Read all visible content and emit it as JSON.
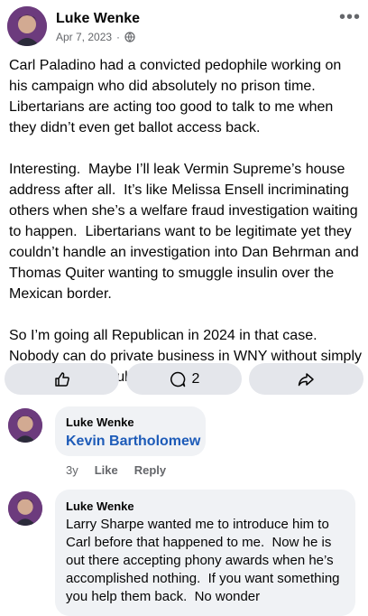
{
  "post": {
    "author": "Luke Wenke",
    "date": "Apr 7, 2023",
    "dot": "·",
    "more": "•••",
    "text": "Carl Paladino had a convicted pedophile working on his campaign who did absolutely no prison time.\nLibertarians are acting too good to talk to me when they didn’t even get ballot access back.\n\nInteresting.  Maybe I’ll leak Vermin Supreme’s house address after all.  It’s like Melissa Ensell incriminating others when she’s a welfare fraud investigation waiting to happen.  Libertarians want to be legitimate yet they couldn’t handle an investigation into Dan Behrman and Thomas Quiter wanting to smuggle insulin over the Mexican border.\n\nSo I’m going all Republican in 2024 in that case.  Nobody can do private business in WNY without simply knowing the Republicans."
  },
  "actions": {
    "like_icon": "thumbs-up-icon",
    "comment_count": "2",
    "comment_icon": "comment-icon",
    "share_icon": "share-icon"
  },
  "comments": [
    {
      "author": "Luke Wenke",
      "mention": "Kevin Bartholomew",
      "age": "3y",
      "like": "Like",
      "reply": "Reply"
    },
    {
      "author": "Luke Wenke",
      "text": "Larry Sharpe wanted me to introduce him to Carl before that happened to me.  Now he is out there accepting phony awards when he’s accomplished nothing.  If you want something you help them back.  No wonder"
    }
  ],
  "colors": {
    "mention": "#1d5bb8",
    "button_bg": "#e4e6eb",
    "bubble_bg": "#f0f2f5",
    "meta": "#65676b"
  }
}
